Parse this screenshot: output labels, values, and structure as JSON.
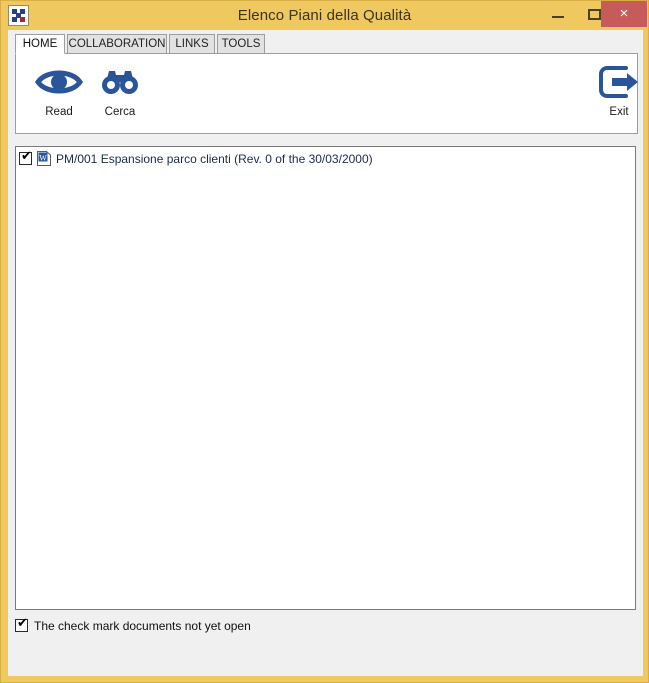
{
  "window": {
    "title": "Elenco Piani della Qualità",
    "app_icon": "app-grid-icon",
    "controls": {
      "minimize": "minimize-icon",
      "maximize": "maximize-icon",
      "close_label": "×"
    },
    "colors": {
      "titlebar": "#EFC960",
      "close_button": "#C75B5B",
      "client": "#F0F0F0",
      "ribbon": "#FFFFFF",
      "icon_blue": "#2A5699",
      "list_text": "#1B2A4A"
    }
  },
  "ribbon": {
    "tabs": [
      {
        "label": "HOME",
        "active": true
      },
      {
        "label": "COLLABORATION",
        "active": false
      },
      {
        "label": "LINKS",
        "active": false
      },
      {
        "label": "TOOLS",
        "active": false
      }
    ],
    "commands": [
      {
        "label": "Read",
        "icon": "eye-icon"
      },
      {
        "label": "Cerca",
        "icon": "binoculars-icon"
      },
      {
        "label": "Exit",
        "icon": "exit-arrow-icon"
      }
    ]
  },
  "list": {
    "rows": [
      {
        "checked": true,
        "check_glyph": "✔",
        "icon": "word-document-icon",
        "text": "PM/001 Espansione parco clienti (Rev. 0 of the 30/03/2000)"
      }
    ]
  },
  "footer": {
    "checkbox": {
      "checked": true,
      "check_glyph": "✔",
      "label": "The check mark documents not yet open"
    }
  }
}
